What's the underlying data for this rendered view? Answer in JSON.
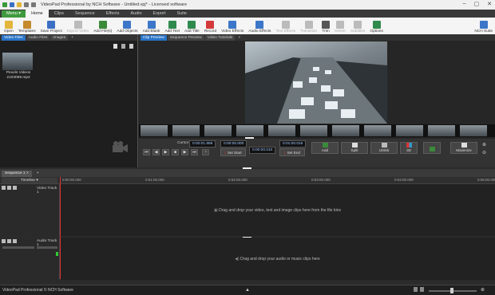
{
  "window": {
    "title": "VideoPad Professional by NCH Software - Untitled.vpj* - Licensed software"
  },
  "menu": {
    "menu_button": "Menu",
    "tabs": [
      "Home",
      "Clips",
      "Sequence",
      "Effects",
      "Audio",
      "Export",
      "Suite"
    ]
  },
  "toolbar": {
    "items": [
      {
        "label": "Open",
        "icon": "folder-icon",
        "color": "#e3b53a"
      },
      {
        "label": "Templates",
        "icon": "templates-icon",
        "color": "#c48a2c"
      },
      {
        "label": "Save Project",
        "icon": "save-icon",
        "color": "#3a6fc4"
      },
      {
        "label": "Export Video",
        "icon": "export-icon",
        "color": "#bbbbbb"
      },
      {
        "label": "Add File(s)",
        "icon": "add-file-icon",
        "color": "#3a8a3a"
      },
      {
        "label": "Add Objects",
        "icon": "add-objects-icon",
        "color": "#3c76c9"
      },
      {
        "label": "Add Blank",
        "icon": "add-blank-icon",
        "color": "#3c76c9"
      },
      {
        "label": "Add Text",
        "icon": "add-text-icon",
        "color": "#2f8a4d"
      },
      {
        "label": "Add Title",
        "icon": "add-title-icon",
        "color": "#2f8a4d"
      },
      {
        "label": "Record",
        "icon": "record-icon",
        "color": "#d33a3a"
      },
      {
        "label": "Video Effects",
        "icon": "video-effects-icon",
        "color": "#3c76c9"
      },
      {
        "label": "Audio Effects",
        "icon": "audio-effects-icon",
        "color": "#3c76c9"
      },
      {
        "label": "Text Effects",
        "icon": "text-effects-icon",
        "color": "#bbbbbb"
      },
      {
        "label": "Transition",
        "icon": "transition-icon",
        "color": "#bbbbbb"
      },
      {
        "label": "Trim",
        "icon": "trim-icon",
        "color": "#555555"
      },
      {
        "label": "Delete",
        "icon": "delete-icon",
        "color": "#bbbbbb"
      },
      {
        "label": "Subtitles",
        "icon": "subtitles-icon",
        "color": "#bbbbbb"
      },
      {
        "label": "Options",
        "icon": "options-icon",
        "color": "#2f8a4d"
      },
      {
        "label": "NCH Suite",
        "icon": "nch-suite-icon",
        "color": "#3c76c9"
      }
    ]
  },
  "bins": {
    "tabs": [
      "Video Files",
      "Audio Files",
      "Images"
    ],
    "clip": {
      "name": "Pexels Videos 2103099.mp4"
    }
  },
  "preview": {
    "tabs": [
      "Clip Preview",
      "Sequence Preview",
      "Video Tutorials"
    ],
    "title": "Pexels Videos 2103099.mp4",
    "cursor_label": "Cursor :",
    "cursor_time": "0:00:01.988",
    "start_time": "0:00:00.000",
    "duration": "0:00:00.010",
    "end_time": "0:01:00.016",
    "set_start": "Set Start",
    "set_end": "Set End",
    "buttons": [
      "Add",
      "Split",
      "Unlink",
      "3D",
      "Maximize"
    ]
  },
  "sequence": {
    "tab": "Sequence 1",
    "timeline_label": "Timeline",
    "ruler_times": [
      "0:00:00.000",
      "0:01:00.000",
      "0:02:00.000",
      "0:03:00.000",
      "0:04:00.000",
      "0:05:00.000"
    ],
    "video_track": "Video Track 1",
    "audio_track": "Audio Track 1",
    "video_hint": "Drag and drop your video, text and image clips here from the file bins",
    "audio_hint": "Drag and drop your audio or music clips here"
  },
  "status": {
    "text": "VideoPad Professional © NCH Software",
    "zoom": 0.45
  }
}
